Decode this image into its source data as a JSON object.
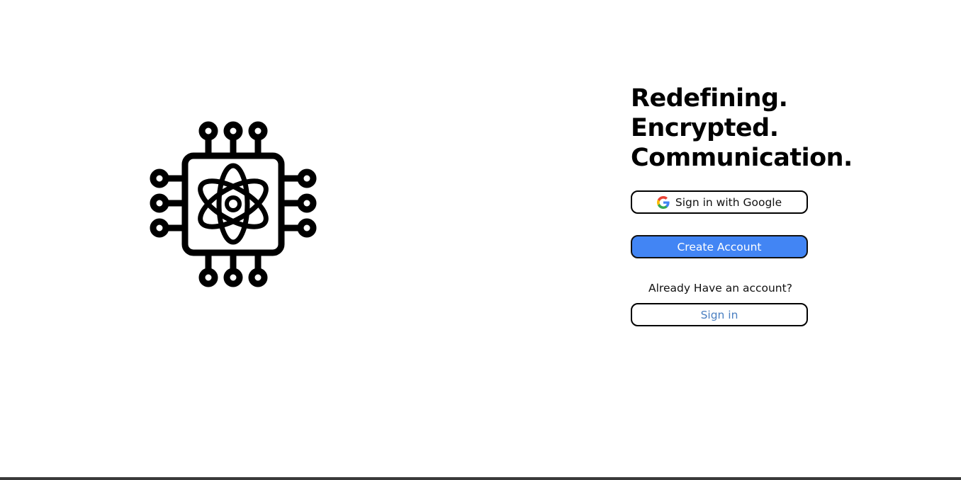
{
  "headline": {
    "line1": "Redefining.",
    "line2": "Encrypted.",
    "line3": "Communication."
  },
  "buttons": {
    "google_label": "Sign in with Google",
    "create_label": "Create Account",
    "signin_label": "Sign in"
  },
  "prompt": {
    "already_text": "Already Have an account?"
  },
  "icons": {
    "logo": "chip-atom-icon",
    "google": "google-icon"
  },
  "colors": {
    "primary": "#4285f4",
    "link": "#4a7fc1",
    "text": "#000000",
    "background": "#ffffff"
  }
}
